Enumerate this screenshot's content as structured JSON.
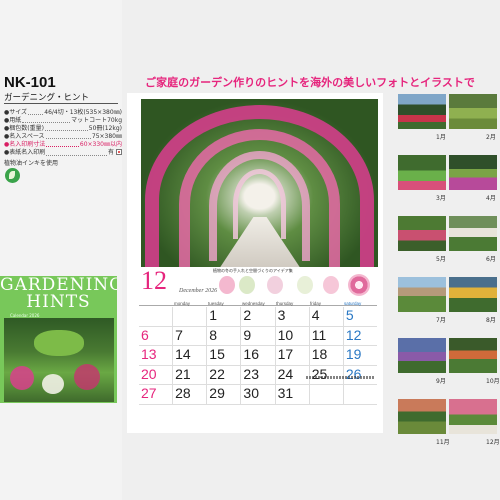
{
  "product": {
    "code": "NK-101",
    "name": "ガーデニング・ヒント"
  },
  "specs": [
    {
      "label": "●サイズ",
      "value": "46/4切・13枚(535×380㎜)",
      "highlight": false
    },
    {
      "label": "●用紙",
      "value": "マットコート70kg",
      "highlight": false
    },
    {
      "label": "●梱包数(重量)",
      "value": "50冊(12kg)",
      "highlight": false
    },
    {
      "label": "●名入スペース",
      "value": "75×380㎜",
      "highlight": false
    },
    {
      "label": "●名入印刷寸法",
      "value": "60×330㎜以内",
      "highlight": true
    },
    {
      "label": "●表紙名入印刷",
      "value": "有",
      "highlight": false
    }
  ],
  "ink_note": "植物油インキを使用",
  "cover": {
    "title_line1": "GARDENING",
    "title_line2": "HINTS",
    "subtitle": "Calendar 2026"
  },
  "headline": "ご家庭のガーデン作りのヒントを海外の美しいフォトとイラストで",
  "calendar": {
    "month_number": "12",
    "month_name": "December 2026",
    "note_title": "植物の冬の手入れと空間づくりのアイデア集",
    "weekdays": [
      "monday",
      "tuesday",
      "wednesday",
      "thursday",
      "friday",
      "saturday"
    ],
    "weeks": [
      [
        "",
        "",
        "1",
        "2",
        "3",
        "4",
        "5"
      ],
      [
        "6",
        "7",
        "8",
        "9",
        "10",
        "11",
        "12"
      ],
      [
        "13",
        "14",
        "15",
        "16",
        "17",
        "18",
        "19"
      ],
      [
        "20",
        "21",
        "22",
        "23",
        "24",
        "25",
        "26"
      ],
      [
        "27",
        "28",
        "29",
        "30",
        "31",
        "",
        ""
      ]
    ]
  },
  "thumbnails": [
    {
      "left": "1月",
      "right": "2月"
    },
    {
      "left": "3月",
      "right": "4月"
    },
    {
      "left": "5月",
      "right": "6月"
    },
    {
      "left": "7月",
      "right": "8月"
    },
    {
      "left": "9月",
      "right": "10月"
    },
    {
      "left": "11月",
      "right": "12月"
    }
  ],
  "colors": {
    "accent_pink": "#e6257d",
    "saturday_blue": "#2a78c4",
    "cover_green": "#78c85a"
  }
}
